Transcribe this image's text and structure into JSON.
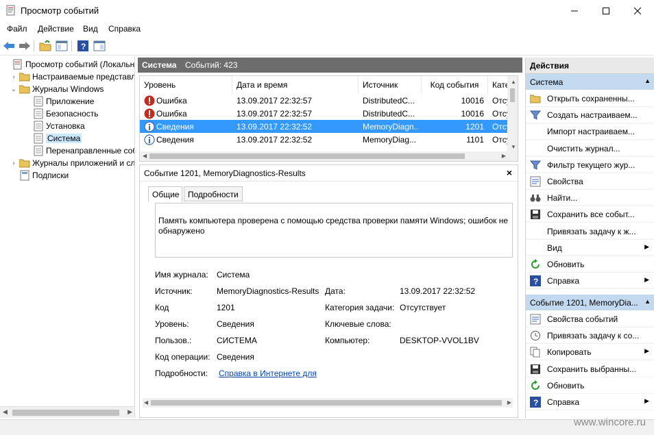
{
  "window": {
    "title": "Просмотр событий"
  },
  "menu": [
    "Файл",
    "Действие",
    "Вид",
    "Справка"
  ],
  "tree": [
    {
      "label": "Просмотр событий (Локальнь",
      "level": 0,
      "exp": ""
    },
    {
      "label": "Настраиваемые представле",
      "level": 1,
      "exp": "›"
    },
    {
      "label": "Журналы Windows",
      "level": 1,
      "exp": "⌄"
    },
    {
      "label": "Приложение",
      "level": 2,
      "exp": ""
    },
    {
      "label": "Безопасность",
      "level": 2,
      "exp": ""
    },
    {
      "label": "Установка",
      "level": 2,
      "exp": ""
    },
    {
      "label": "Система",
      "level": 2,
      "exp": ""
    },
    {
      "label": "Перенаправленные соб",
      "level": 2,
      "exp": ""
    },
    {
      "label": "Журналы приложений и сл",
      "level": 1,
      "exp": "›"
    },
    {
      "label": "Подписки",
      "level": 1,
      "exp": ""
    }
  ],
  "center": {
    "log_name": "Система",
    "count_label": "Событий: 423"
  },
  "events": {
    "columns": [
      "Уровень",
      "Дата и время",
      "Источник",
      "Код события",
      "Кате"
    ],
    "rows": [
      {
        "level": "Ошибка",
        "datetime": "13.09.2017 22:32:57",
        "source": "DistributedC...",
        "code": "10016",
        "cat": "Отсу"
      },
      {
        "level": "Ошибка",
        "datetime": "13.09.2017 22:32:57",
        "source": "DistributedC...",
        "code": "10016",
        "cat": "Отсу"
      },
      {
        "level": "Сведения",
        "datetime": "13.09.2017 22:32:52",
        "source": "MemoryDiagn...",
        "code": "1201",
        "cat": "Отсу"
      },
      {
        "level": "Сведения",
        "datetime": "13.09.2017 22:32:52",
        "source": "MemoryDiag...",
        "code": "1101",
        "cat": "Отсу"
      }
    ]
  },
  "detail": {
    "title": "Событие 1201, MemoryDiagnostics-Results",
    "close": "×",
    "tabs": [
      "Общие",
      "Подробности"
    ],
    "description": "Память компьютера проверена с помощью средства проверки памяти Windows; ошибок не обнаружено",
    "fields": {
      "log_label": "Имя журнала:",
      "log_value": "Система",
      "source_label": "Источник:",
      "source_value": "MemoryDiagnostics-Results",
      "date_label": "Дата:",
      "date_value": "13.09.2017 22:32:52",
      "code_label": "Код",
      "code_value": "1201",
      "task_label": "Категория задачи:",
      "task_value": "Отсутствует",
      "level_label": "Уровень:",
      "level_value": "Сведения",
      "keywords_label": "Ключевые слова:",
      "user_label": "Пользов.:",
      "user_value": "СИСТЕМА",
      "computer_label": "Компьютер:",
      "computer_value": "DESKTOP-VVOL1BV",
      "opcode_label": "Код операции:",
      "opcode_value": "Сведения",
      "more_label": "Подробности:",
      "more_link": "Справка в Интернете для"
    }
  },
  "actions": {
    "title": "Действия",
    "section1": "Система",
    "items1": [
      {
        "label": "Открыть сохраненны...",
        "icon": "folder-icon",
        "sub": false
      },
      {
        "label": "Создать настраиваем...",
        "icon": "filter-icon",
        "sub": false
      },
      {
        "label": "Импорт настраиваем...",
        "icon": "",
        "sub": false
      },
      {
        "label": "Очистить журнал...",
        "icon": "",
        "sub": false
      },
      {
        "label": "Фильтр текущего жур...",
        "icon": "filter-icon",
        "sub": false
      },
      {
        "label": "Свойства",
        "icon": "properties-icon",
        "sub": false
      },
      {
        "label": "Найти...",
        "icon": "binoculars-icon",
        "sub": false
      },
      {
        "label": "Сохранить все событ...",
        "icon": "save-icon",
        "sub": false
      },
      {
        "label": "Привязать задачу к ж...",
        "icon": "",
        "sub": false
      },
      {
        "label": "Вид",
        "icon": "",
        "sub": true
      },
      {
        "label": "Обновить",
        "icon": "refresh-icon",
        "sub": false
      },
      {
        "label": "Справка",
        "icon": "help-icon",
        "sub": true
      }
    ],
    "section2": "Событие 1201, MemoryDia...",
    "items2": [
      {
        "label": "Свойства событий",
        "icon": "properties-icon",
        "sub": false
      },
      {
        "label": "Привязать задачу к со...",
        "icon": "task-icon",
        "sub": false
      },
      {
        "label": "Копировать",
        "icon": "copy-icon",
        "sub": true
      },
      {
        "label": "Сохранить выбранны...",
        "icon": "save-icon",
        "sub": false
      },
      {
        "label": "Обновить",
        "icon": "refresh-icon",
        "sub": false
      },
      {
        "label": "Справка",
        "icon": "help-icon",
        "sub": true
      }
    ]
  },
  "watermark": "www.wincore.ru"
}
